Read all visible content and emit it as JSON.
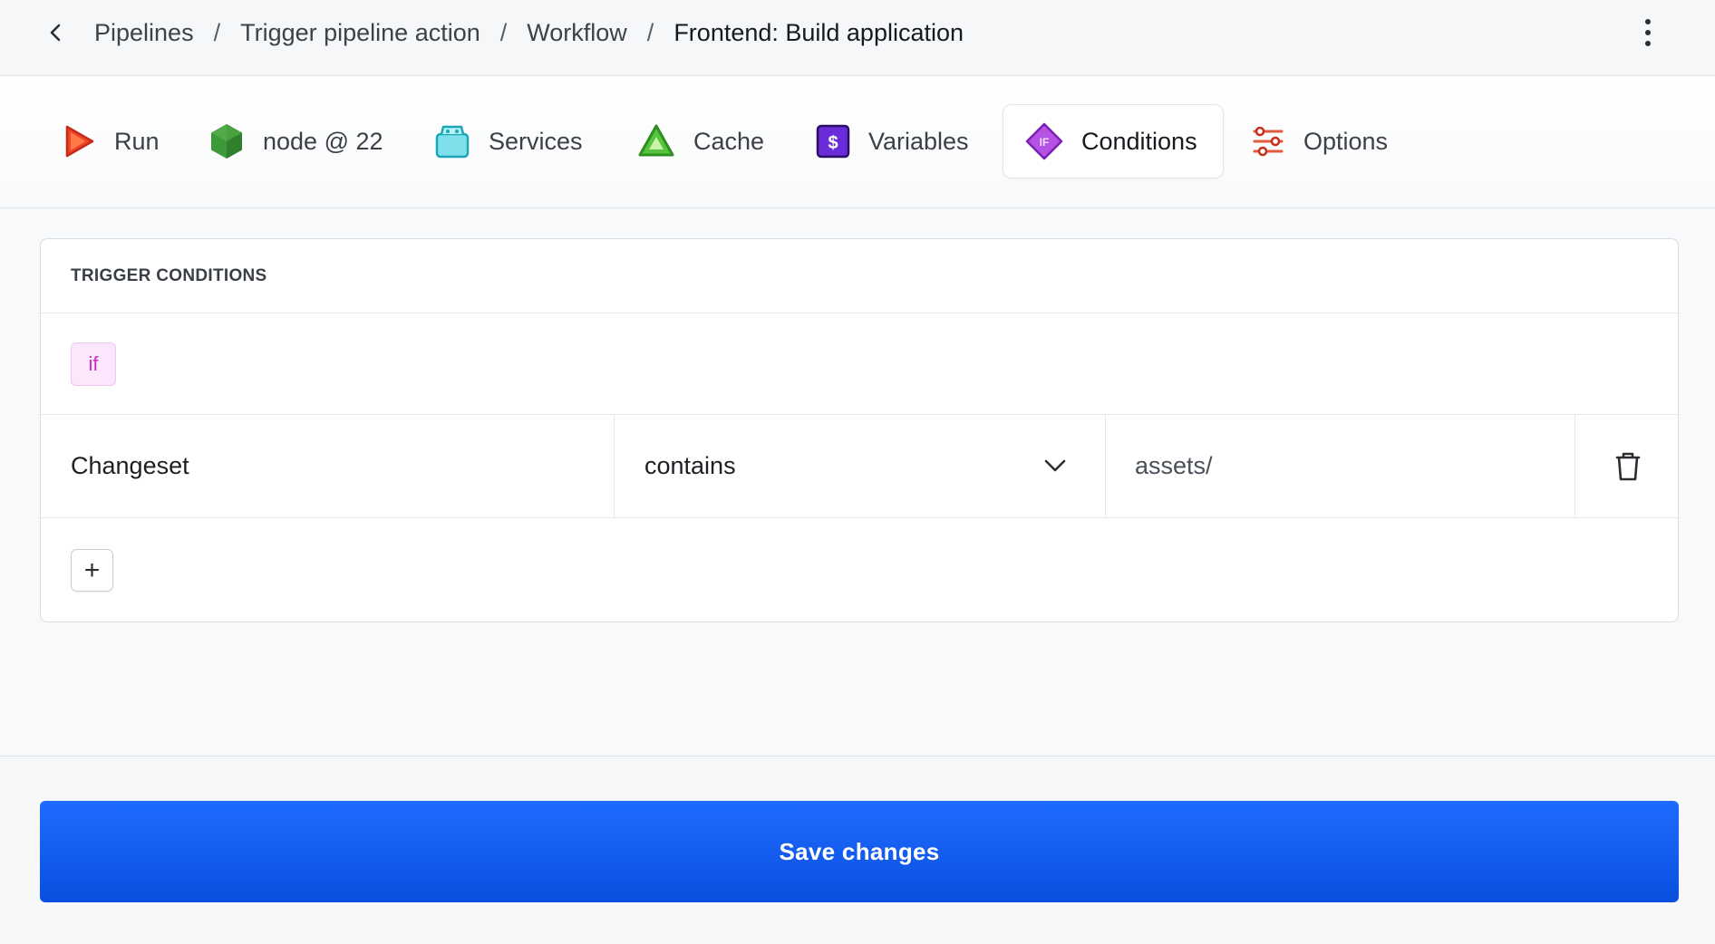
{
  "header": {
    "back_icon": "chevron-left-icon",
    "breadcrumbs": [
      "Pipelines",
      "Trigger pipeline action",
      "Workflow",
      "Frontend: Build application"
    ],
    "separator": "/",
    "menu_icon": "kebab-menu-icon"
  },
  "tabs": [
    {
      "label": "Run",
      "icon": "play-icon",
      "active": false
    },
    {
      "label": "node @ 22",
      "icon": "nodejs-hexagon-icon",
      "active": false
    },
    {
      "label": "Services",
      "icon": "services-box-icon",
      "active": false
    },
    {
      "label": "Cache",
      "icon": "cache-triangle-icon",
      "active": false
    },
    {
      "label": "Variables",
      "icon": "dollar-variable-icon",
      "active": false
    },
    {
      "label": "Conditions",
      "icon": "if-diamond-icon",
      "active": true
    },
    {
      "label": "Options",
      "icon": "sliders-options-icon",
      "active": false
    }
  ],
  "conditions": {
    "title": "TRIGGER CONDITIONS",
    "if_badge": "if",
    "rows": [
      {
        "field": "Changeset",
        "operator": "contains",
        "value": "assets/"
      }
    ],
    "add_label": "+"
  },
  "footer": {
    "save_label": "Save changes"
  },
  "colors": {
    "primary": "#0a56f0",
    "if_badge_bg": "#fbe7fb",
    "if_badge_text": "#c52ec8"
  }
}
